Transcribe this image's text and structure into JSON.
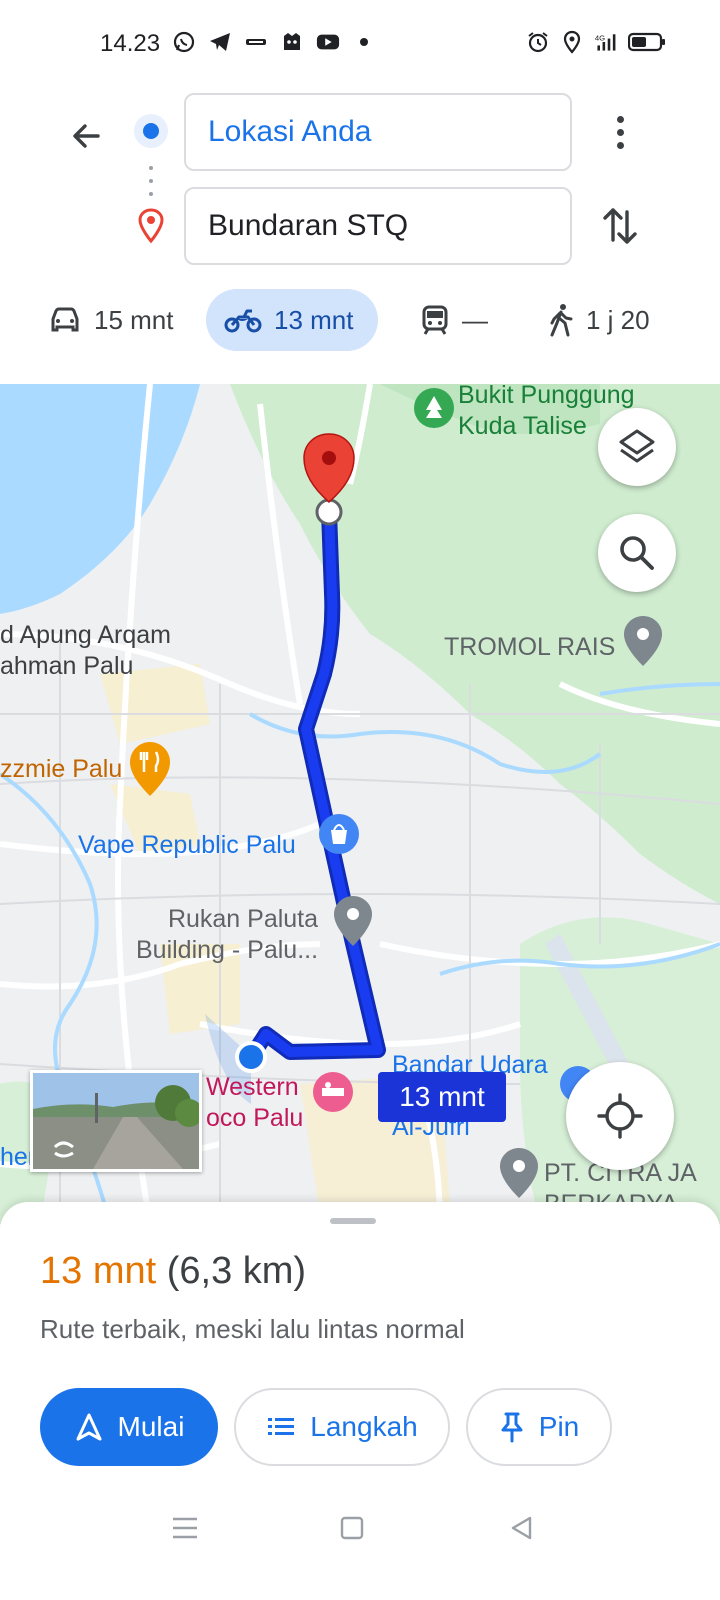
{
  "status_bar": {
    "time": "14.23",
    "left_icons": [
      "whatsapp-icon",
      "telegram-icon",
      "bank-app-icon",
      "game-app-icon",
      "youtube-icon",
      "notification-dot-icon"
    ],
    "right_icons": [
      "alarm-icon",
      "location-icon",
      "signal-4g-icon",
      "battery-icon"
    ]
  },
  "directions": {
    "origin": "Lokasi Anda",
    "destination": "Bundaran STQ"
  },
  "modes": [
    {
      "name": "car",
      "label": "15 mnt"
    },
    {
      "name": "motorcycle",
      "label": "13 mnt",
      "selected": true
    },
    {
      "name": "transit",
      "label": "—"
    },
    {
      "name": "walk",
      "label": "1 j 20"
    }
  ],
  "map": {
    "labels": {
      "bukit_punggung": "Bukit Punggung\nKuda Talise",
      "tromol_rais": "TROMOL RAIS",
      "apung_arqam": "d Apung Arqam\nahman Palu",
      "pizzmie": "zzmie Palu",
      "vape_republic": "Vape Republic Palu",
      "rukan_paluta": "Rukan Paluta\nBuilding - Palu...",
      "western": "Western\noco Palu",
      "bandar_udara": "Bandar Udara\nSIS\nAl-Jufri",
      "citra": "PT. CITRA JA\nBERKARYA",
      "edge_her": "her"
    },
    "route_time": "13 mnt",
    "route_color": "#1a34d8"
  },
  "sheet": {
    "time": "13 mnt",
    "distance": "(6,3 km)",
    "description": "Rute terbaik, meski lalu lintas normal",
    "buttons": {
      "start": "Mulai",
      "steps": "Langkah",
      "pin": "Pin"
    }
  },
  "colors": {
    "accent": "#1a73e8",
    "time_orange": "#e37400",
    "pin_red": "#ea4335"
  }
}
